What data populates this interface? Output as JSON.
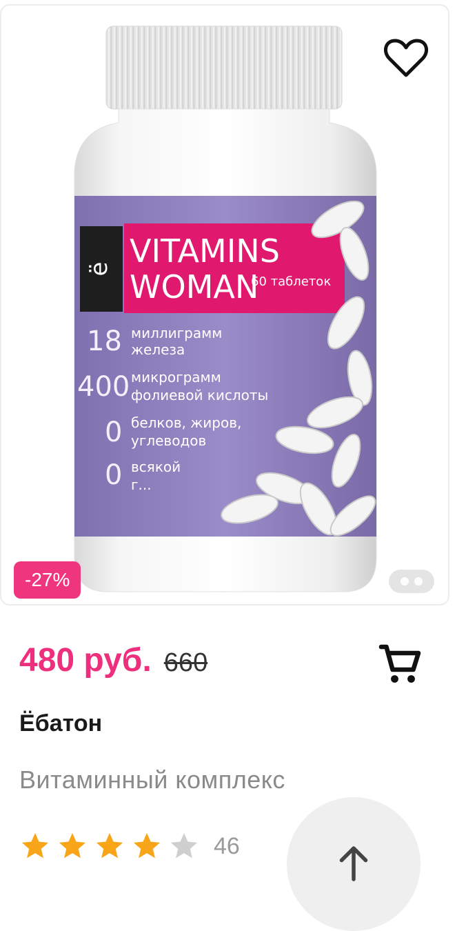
{
  "product": {
    "discount": "-27%",
    "price": "480 руб.",
    "old_price": "660",
    "brand": "Ёбатон",
    "description": "Витаминный комплекс",
    "rating": 4,
    "rating_max": 5,
    "reviews_count": "46",
    "image": {
      "brand_letter": "ё",
      "title_line1": "VITAMINS",
      "title_line2": "WOMAN",
      "count": "60 таблеток",
      "facts": [
        {
          "number": "18",
          "text1": "миллиграмм",
          "text2": "железа"
        },
        {
          "number": "400",
          "text1": "микрограмм",
          "text2": "фолиевой кислоты"
        },
        {
          "number": "0",
          "text1": "белков, жиров,",
          "text2": "углеводов"
        },
        {
          "number": "0",
          "text1": "всякой",
          "text2": "г..."
        }
      ]
    }
  },
  "colors": {
    "accent": "#ee2f7d",
    "badge": "#f0357f",
    "label_purple": "#8d7ebd",
    "label_pink": "#e0196f"
  },
  "icons": {
    "favorite": "heart-outline-icon",
    "cart": "cart-icon",
    "star": "star-icon",
    "scroll_top": "arrow-up-icon"
  }
}
